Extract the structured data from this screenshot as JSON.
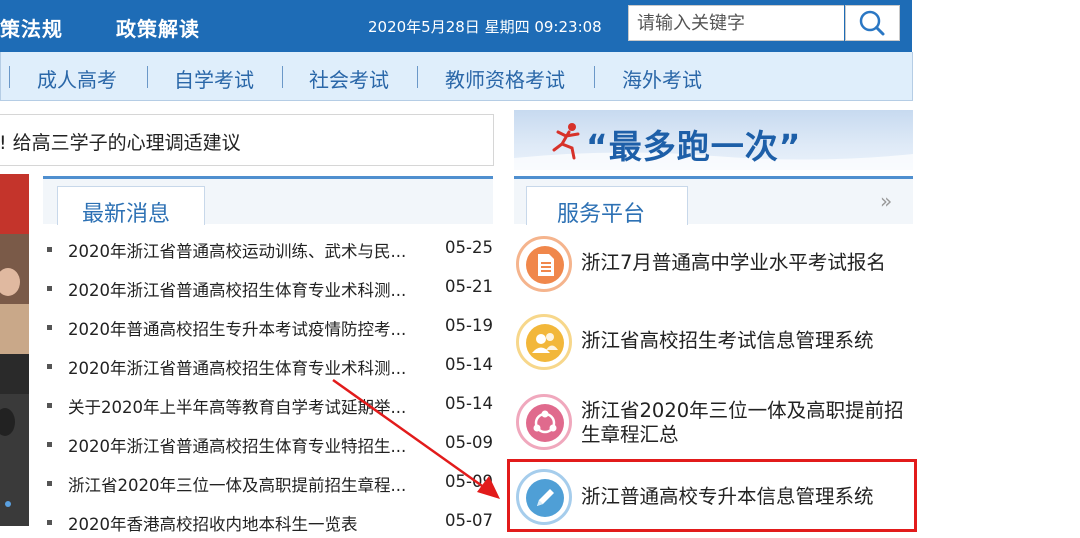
{
  "header": {
    "nav": [
      "策法规",
      "政策解读"
    ],
    "datetime": "2020年5月28日 星期四 09:23:08",
    "search_placeholder": "请输入关键字",
    "search_icon": "search-icon"
  },
  "subnav": [
    "成人高考",
    "自学考试",
    "社会考试",
    "教师资格考试",
    "海外考试"
  ],
  "headline": "!  给高三学子的心理调适建议",
  "news": {
    "tab_label": "最新消息",
    "items": [
      {
        "title": "2020年浙江省普通高校运动训练、武术与民...",
        "date": "05-25"
      },
      {
        "title": "2020年浙江省普通高校招生体育专业术科测...",
        "date": "05-21"
      },
      {
        "title": "2020年普通高校招生专升本考试疫情防控考...",
        "date": "05-19"
      },
      {
        "title": "2020年浙江省普通高校招生体育专业术科测...",
        "date": "05-14"
      },
      {
        "title": "关于2020年上半年高等教育自学考试延期举...",
        "date": "05-14"
      },
      {
        "title": "2020年浙江省普通高校招生体育专业特招生...",
        "date": "05-09"
      },
      {
        "title": "浙江省2020年三位一体及高职提前招生章程...",
        "date": "05-09"
      },
      {
        "title": "2020年香港高校招收内地本科生一览表",
        "date": "05-07"
      }
    ]
  },
  "banner": {
    "text": "“最多跑一次”"
  },
  "services": {
    "tab_label": "服务平台",
    "more_icon": "double-chevron-right-icon",
    "items": [
      {
        "label": "浙江7月普通高中学业水平考试报名",
        "icon": "document-icon",
        "color": "#f0874b"
      },
      {
        "label": "浙江省高校招生考试信息管理系统",
        "icon": "users-icon",
        "color": "#f2b73a"
      },
      {
        "label": "浙江省2020年三位一体及高职提前招生章程汇总",
        "icon": "share-icon",
        "color": "#e06a8d"
      },
      {
        "label": "浙江普通高校专升本信息管理系统",
        "icon": "pencil-icon",
        "color": "#4f9fd6"
      }
    ]
  }
}
